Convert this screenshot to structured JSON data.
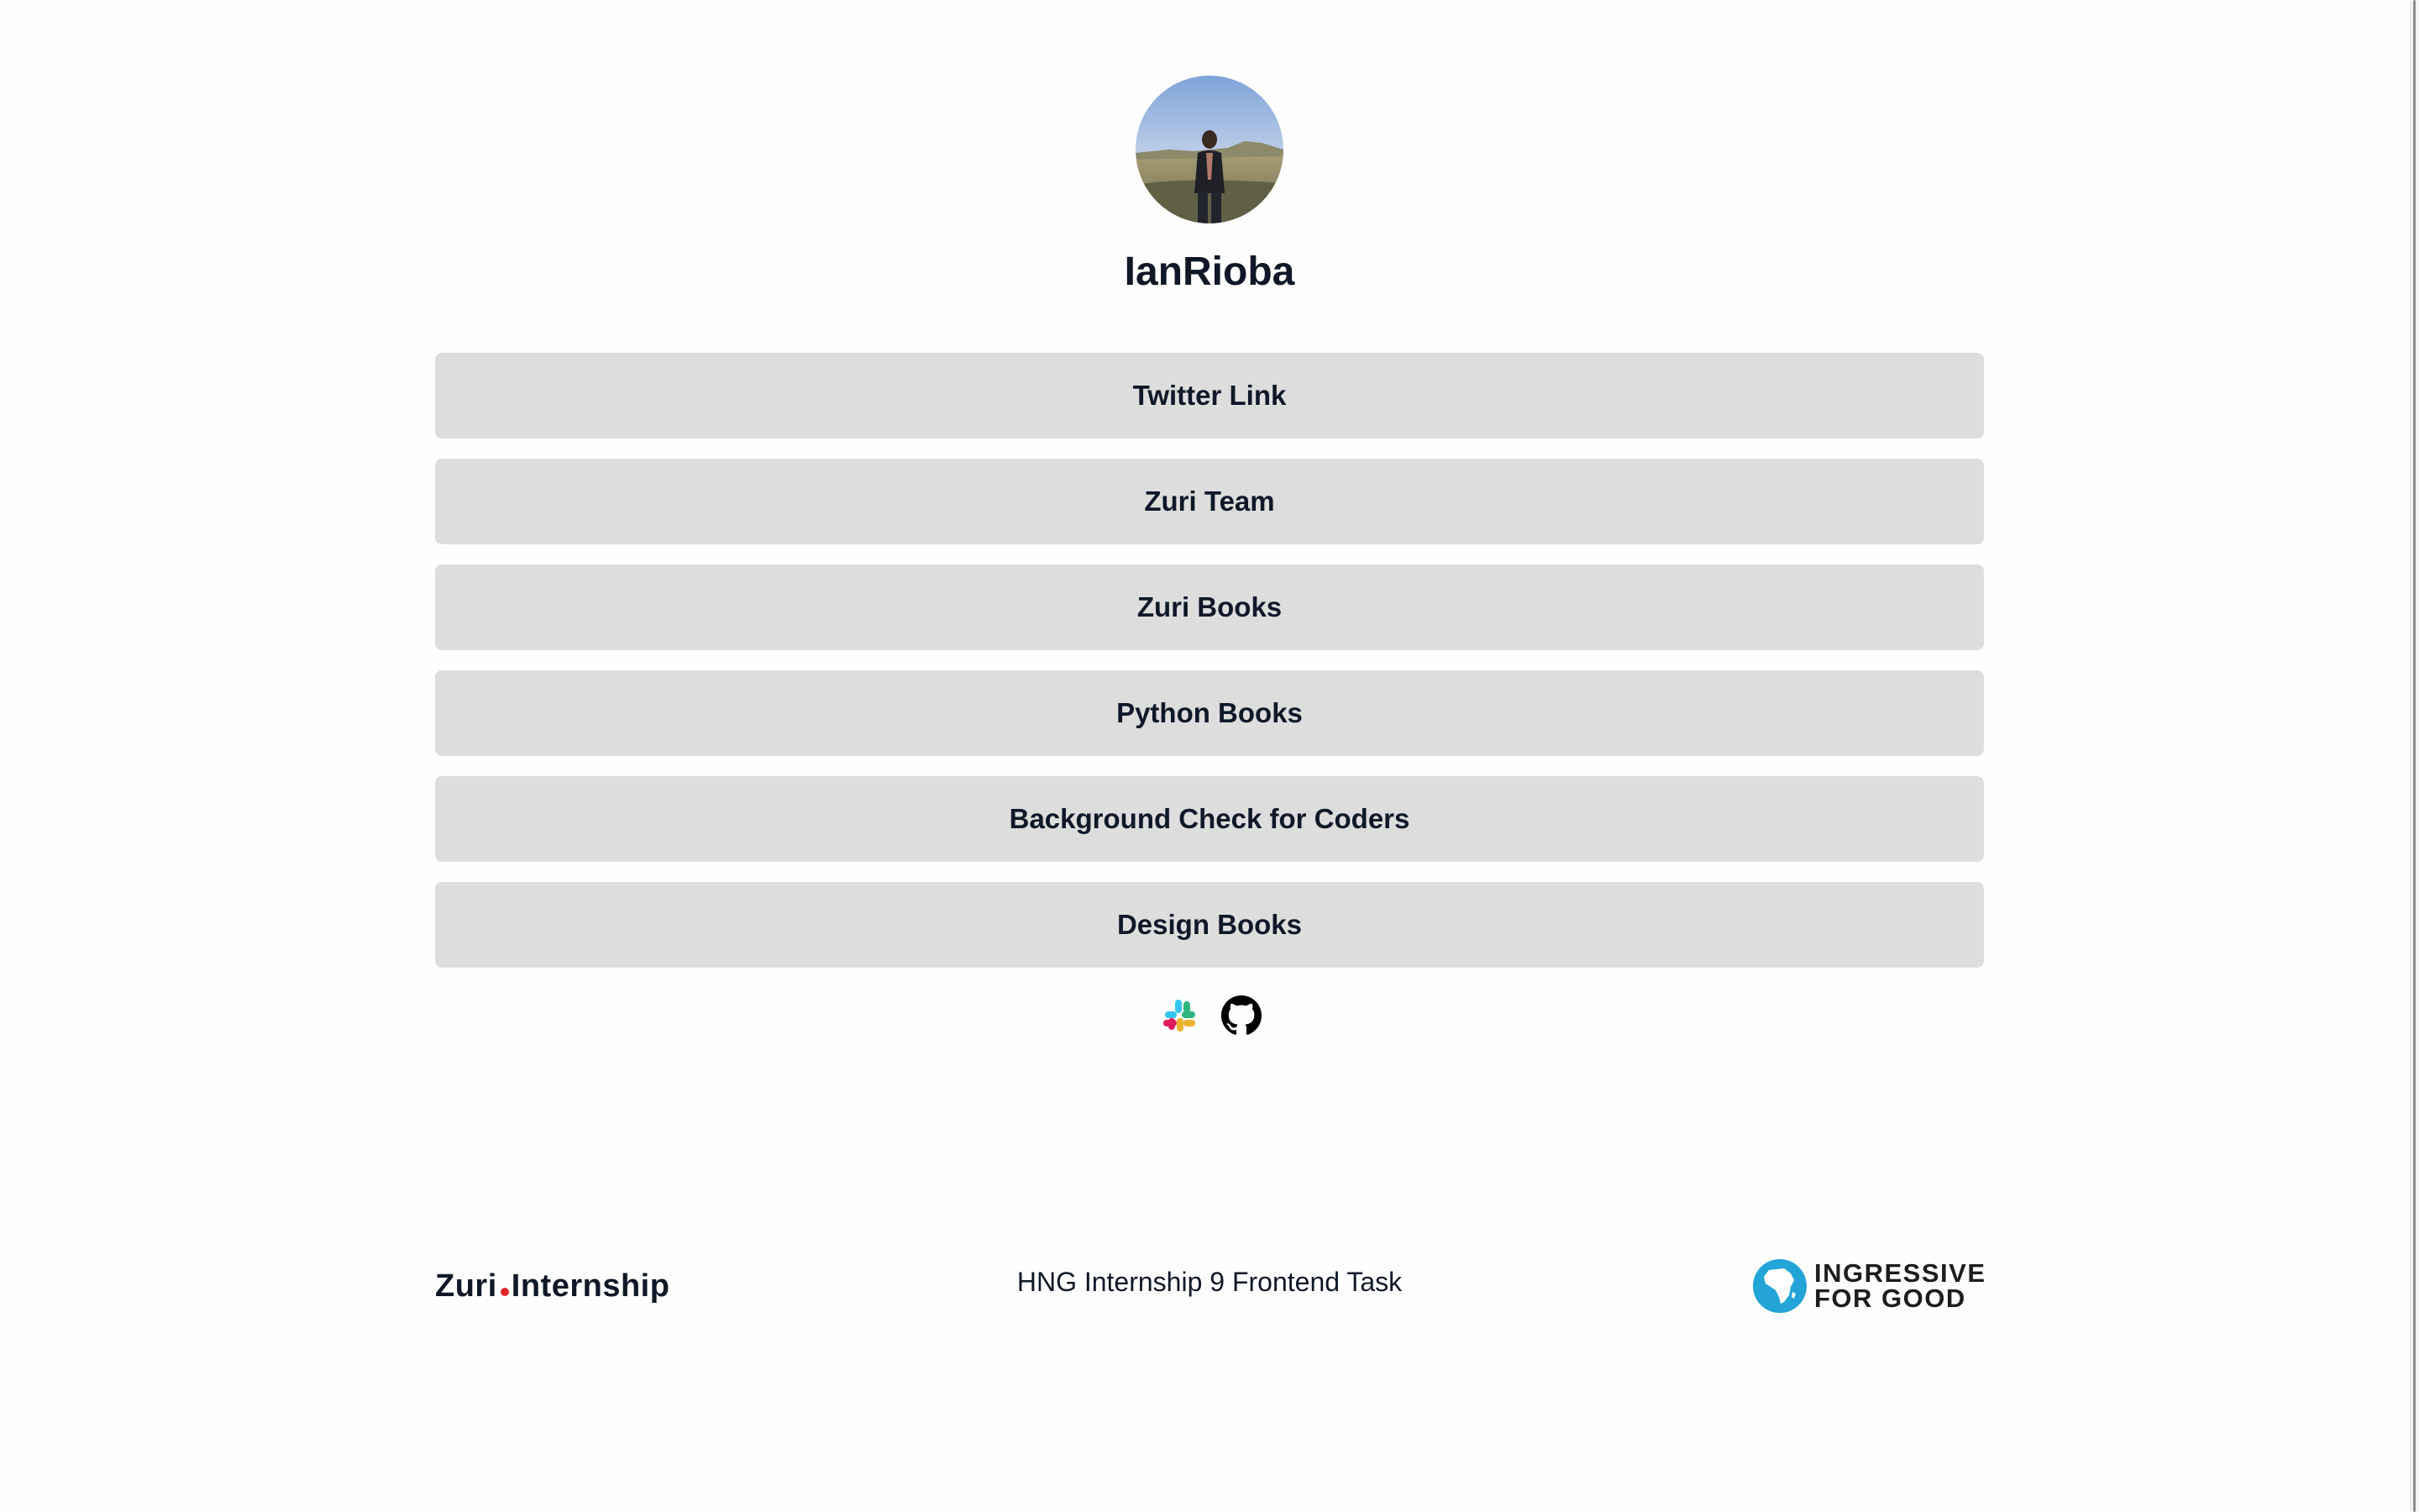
{
  "profile": {
    "name": "IanRioba",
    "avatar_alt": "IanRioba"
  },
  "links": [
    {
      "label": "Twitter Link"
    },
    {
      "label": "Zuri Team"
    },
    {
      "label": "Zuri Books"
    },
    {
      "label": "Python Books"
    },
    {
      "label": "Background Check for Coders"
    },
    {
      "label": "Design Books"
    }
  ],
  "socials": [
    {
      "icon": "slack-icon"
    },
    {
      "icon": "github-icon"
    }
  ],
  "footer": {
    "zuri_part1": "Zuri",
    "zuri_part2": "Internship",
    "center_text": "HNG Internship 9 Frontend Task",
    "i4g_line1": "INGRESSIVE",
    "i4g_line2": "FOR GOOD"
  },
  "colors": {
    "button_bg": "#dddddd",
    "text": "#101828",
    "zuri_dot": "#e3262b",
    "i4g_blue": "#22a4d6"
  }
}
